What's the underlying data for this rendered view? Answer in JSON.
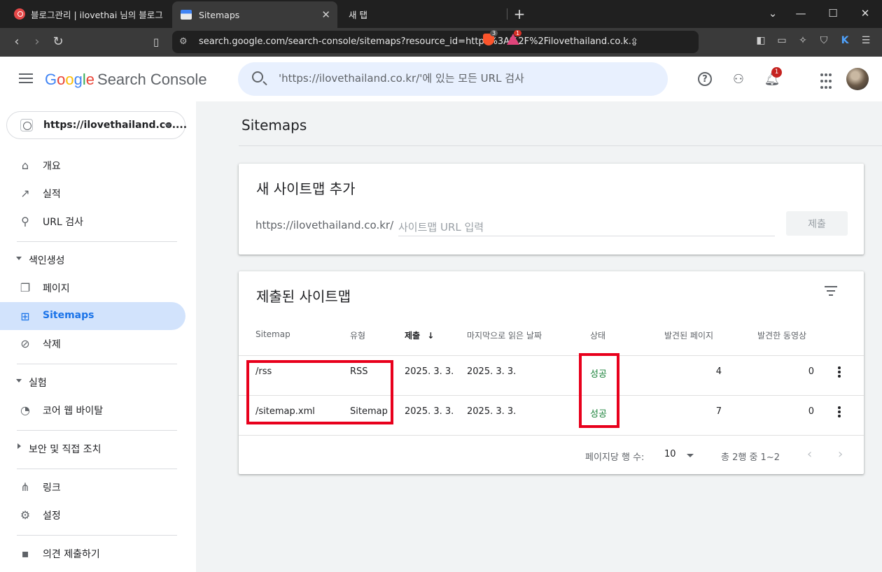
{
  "browser": {
    "tabs": [
      {
        "label": "블로그관리 | ilovethai 님의 블로그"
      },
      {
        "label": "Sitemaps"
      },
      {
        "label": "새 탭"
      }
    ],
    "url": "search.google.com/search-console/sitemaps?resource_id=https%3A%2F%2Filovethailand.co.k...",
    "brave_badge": "3",
    "rewards_badge": "1"
  },
  "header": {
    "brand_g": [
      "G",
      "o",
      "o",
      "g",
      "l",
      "e"
    ],
    "brand_product": "Search Console",
    "search_placeholder": "'https://ilovethailand.co.kr/'에 있는 모든 URL 검사",
    "notification_count": "1"
  },
  "sidebar": {
    "property": "https://ilovethailand.co....",
    "items": [
      {
        "label": "개요"
      },
      {
        "label": "실적"
      },
      {
        "label": "URL 검사"
      }
    ],
    "section_indexing": "색인생성",
    "indexing_items": [
      {
        "label": "페이지"
      },
      {
        "label": "Sitemaps"
      },
      {
        "label": "삭제"
      }
    ],
    "section_experience": "실험",
    "experience_items": [
      {
        "label": "코어 웹 바이탈"
      }
    ],
    "section_security": "보안 및 직접 조치",
    "misc_items": [
      {
        "label": "링크"
      },
      {
        "label": "설정"
      }
    ],
    "feedback": "의견 제출하기"
  },
  "main": {
    "page_title": "Sitemaps",
    "add_card": {
      "title": "새 사이트맵 추가",
      "prefix": "https://ilovethailand.co.kr/",
      "placeholder": "사이트맵 URL 입력",
      "submit_label": "제출"
    },
    "submitted_card": {
      "title": "제출된 사이트맵",
      "columns": [
        "Sitemap",
        "유형",
        "제출",
        "마지막으로 읽은 날짜",
        "상태",
        "발견된 페이지",
        "발견한 동영상"
      ],
      "sort_arrow": "↓",
      "rows": [
        {
          "sitemap": "/rss",
          "type": "RSS",
          "submitted": "2025. 3. 3.",
          "last_read": "2025. 3. 3.",
          "status": "성공",
          "pages": "4",
          "videos": "0"
        },
        {
          "sitemap": "/sitemap.xml",
          "type": "Sitemap",
          "submitted": "2025. 3. 3.",
          "last_read": "2025. 3. 3.",
          "status": "성공",
          "pages": "7",
          "videos": "0"
        }
      ],
      "rows_per_page_label": "페이지당 행 수:",
      "rows_per_page": "10",
      "range_label": "총 2행 중 1~2"
    }
  },
  "colors": {
    "status_success": "#188038",
    "active_nav": "#d2e3fc",
    "highlight_box": "#e8001c"
  }
}
